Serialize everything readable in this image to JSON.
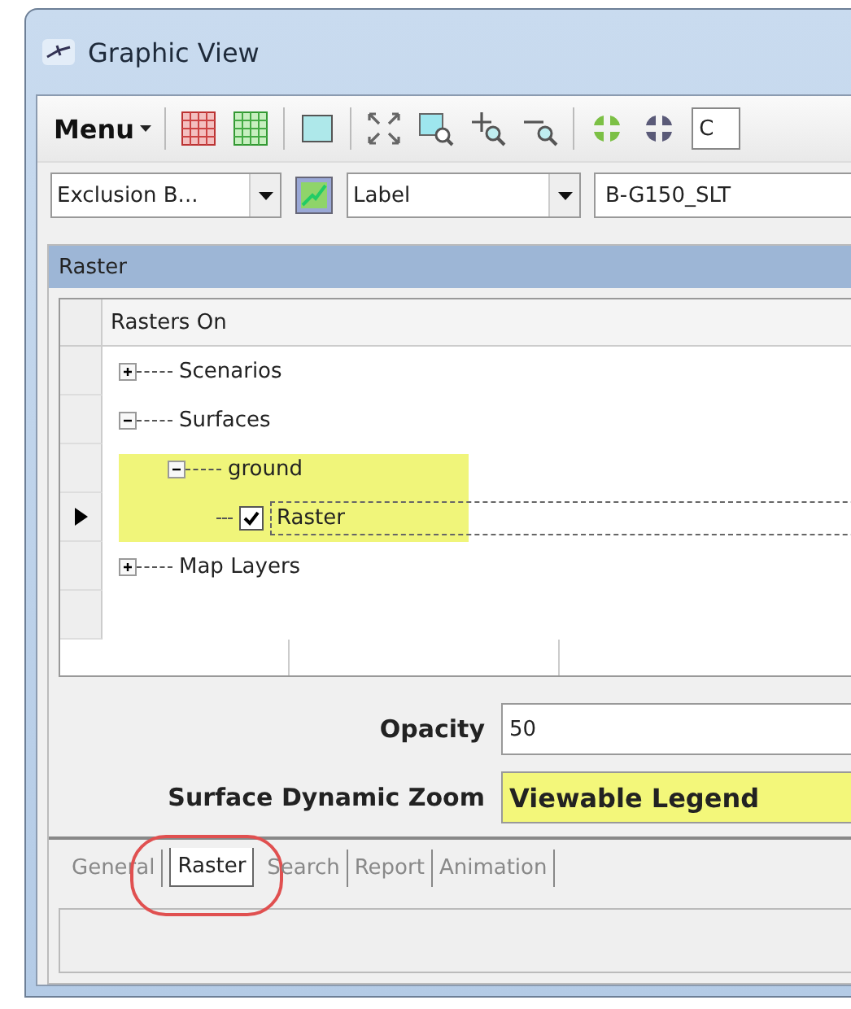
{
  "window": {
    "title": "Graphic View"
  },
  "toolbar": {
    "menu": "Menu",
    "search_value": "C"
  },
  "selectors": {
    "layer": "Exclusion B...",
    "label_field": "Label",
    "value": "B-G150_SLT"
  },
  "panel": {
    "title": "Raster"
  },
  "tree": {
    "column": "Rasters On",
    "nodes": [
      {
        "label": "Scenarios",
        "kind": "folder",
        "expanded": false,
        "selected": false,
        "highlighted": false
      },
      {
        "label": "Surfaces",
        "kind": "folder",
        "expanded": true,
        "selected": false,
        "highlighted": false,
        "children": [
          {
            "label": "ground",
            "kind": "folder",
            "expanded": true,
            "selected": false,
            "highlighted": true,
            "children": [
              {
                "label": "Raster",
                "kind": "checkbox",
                "checked": true,
                "selected": true,
                "highlighted": true
              }
            ]
          }
        ]
      },
      {
        "label": "Map Layers",
        "kind": "folder",
        "expanded": false,
        "selected": false,
        "highlighted": false
      }
    ]
  },
  "properties": [
    {
      "label": "Opacity",
      "value": "50",
      "highlighted": false
    },
    {
      "label": "Surface Dynamic Zoom",
      "value": "Viewable Legend",
      "highlighted": true
    }
  ],
  "tabs": [
    {
      "label": "General",
      "selected": false,
      "circled": false
    },
    {
      "label": "Raster",
      "selected": true,
      "circled": true
    },
    {
      "label": "Search",
      "selected": false,
      "circled": false
    },
    {
      "label": "Report",
      "selected": false,
      "circled": false
    },
    {
      "label": "Animation",
      "selected": false,
      "circled": false
    }
  ]
}
